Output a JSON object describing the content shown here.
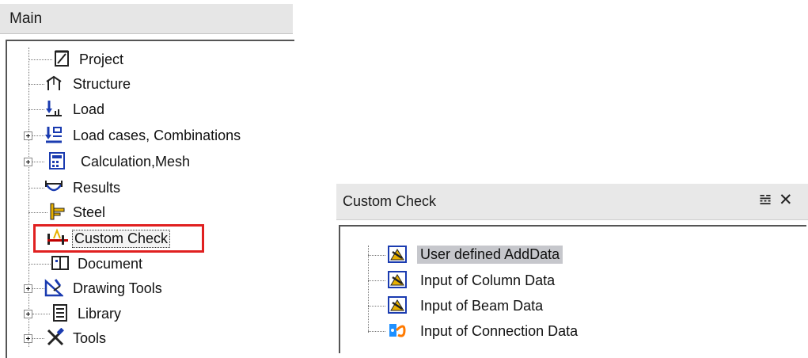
{
  "main_panel": {
    "title": "Main",
    "items": [
      {
        "label": "Project",
        "icon": "project-icon",
        "expandable": false
      },
      {
        "label": "Structure",
        "icon": "structure-icon",
        "expandable": false
      },
      {
        "label": "Load",
        "icon": "load-icon",
        "expandable": false
      },
      {
        "label": "Load cases, Combinations",
        "icon": "load-cases-icon",
        "expandable": true
      },
      {
        "label": "Calculation,Mesh",
        "icon": "calculator-icon",
        "expandable": true
      },
      {
        "label": "Results",
        "icon": "results-icon",
        "expandable": false
      },
      {
        "label": "Steel",
        "icon": "steel-icon",
        "expandable": false
      },
      {
        "label": "Custom Check",
        "icon": "custom-check-icon",
        "expandable": false,
        "selected": true
      },
      {
        "label": "Document",
        "icon": "document-icon",
        "expandable": false
      },
      {
        "label": "Drawing Tools",
        "icon": "drawing-tools-icon",
        "expandable": true
      },
      {
        "label": "Library",
        "icon": "library-icon",
        "expandable": true
      },
      {
        "label": "Tools",
        "icon": "tools-icon",
        "expandable": true
      }
    ]
  },
  "custom_check_panel": {
    "title": "Custom Check",
    "pin_glyph": "ᴲ8",
    "close_glyph": "✕",
    "items": [
      {
        "label": "User defined AddData",
        "icon": "add-data-icon",
        "selected": true
      },
      {
        "label": "Input of Column Data",
        "icon": "add-data-icon"
      },
      {
        "label": "Input of Beam Data",
        "icon": "add-data-icon"
      },
      {
        "label": "Input of Connection Data",
        "icon": "connection-data-icon"
      }
    ]
  },
  "colors": {
    "highlight_border": "#e02020",
    "selection_bg": "#c6c7cc",
    "header_bg": "#e6e6e6"
  }
}
